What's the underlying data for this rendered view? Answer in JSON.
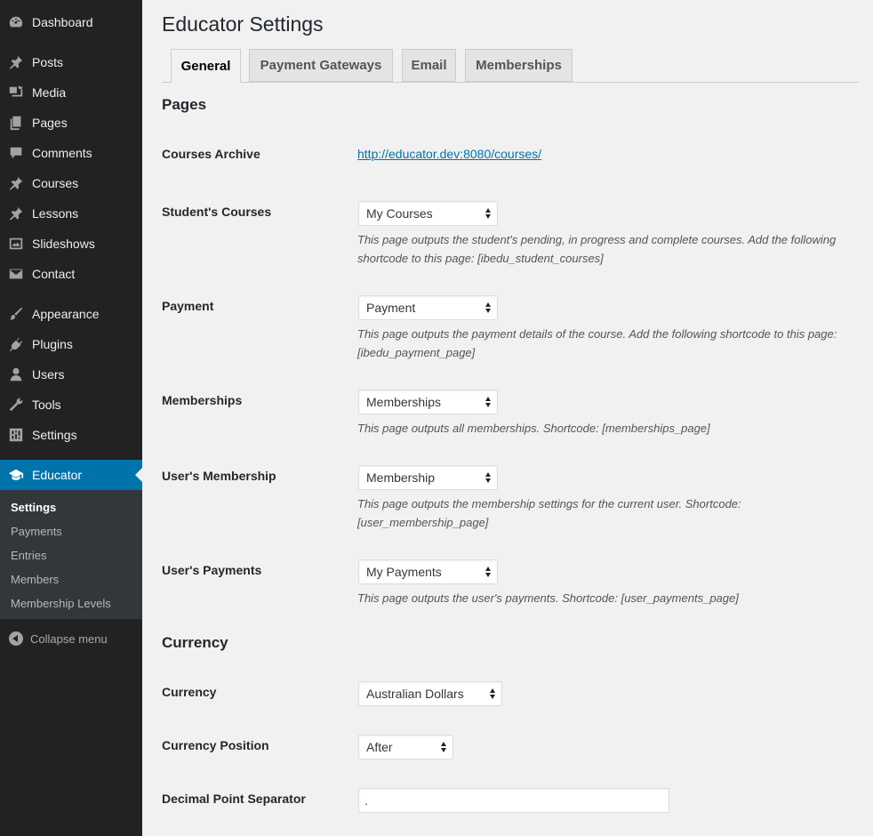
{
  "sidebar": {
    "items": [
      {
        "label": "Dashboard",
        "icon": "dashboard-icon"
      },
      {
        "label": "Posts",
        "icon": "pin-icon"
      },
      {
        "label": "Media",
        "icon": "media-icon"
      },
      {
        "label": "Pages",
        "icon": "pages-icon"
      },
      {
        "label": "Comments",
        "icon": "comment-icon"
      },
      {
        "label": "Courses",
        "icon": "pin-icon"
      },
      {
        "label": "Lessons",
        "icon": "pin-icon"
      },
      {
        "label": "Slideshows",
        "icon": "slideshow-icon"
      },
      {
        "label": "Contact",
        "icon": "mail-icon"
      },
      {
        "label": "Appearance",
        "icon": "brush-icon"
      },
      {
        "label": "Plugins",
        "icon": "plugin-icon"
      },
      {
        "label": "Users",
        "icon": "user-icon"
      },
      {
        "label": "Tools",
        "icon": "wrench-icon"
      },
      {
        "label": "Settings",
        "icon": "sliders-icon"
      },
      {
        "label": "Educator",
        "icon": "graduation-cap-icon"
      }
    ],
    "submenu": [
      "Settings",
      "Payments",
      "Entries",
      "Members",
      "Membership Levels"
    ],
    "collapse_label": "Collapse menu",
    "active_color": "#0073aa"
  },
  "page": {
    "title": "Educator Settings",
    "tabs": [
      "General",
      "Payment Gateways",
      "Email",
      "Memberships"
    ],
    "active_tab": "General"
  },
  "pages_section": {
    "title": "Pages",
    "courses_archive": {
      "label": "Courses Archive",
      "link": "http://educator.dev:8080/courses/"
    },
    "students_courses": {
      "label": "Student's Courses",
      "value": "My Courses",
      "desc": "This page outputs the student's pending, in progress and complete courses. Add the following shortcode to this page: [ibedu_student_courses]"
    },
    "payment": {
      "label": "Payment",
      "value": "Payment",
      "desc": "This page outputs the payment details of the course. Add the following shortcode to this page: [ibedu_payment_page]"
    },
    "memberships": {
      "label": "Memberships",
      "value": "Memberships",
      "desc": "This page outputs all memberships. Shortcode: [memberships_page]"
    },
    "users_membership": {
      "label": "User's Membership",
      "value": "Membership",
      "desc": "This page outputs the membership settings for the current user. Shortcode: [user_membership_page]"
    },
    "users_payments": {
      "label": "User's Payments",
      "value": "My Payments",
      "desc": "This page outputs the user's payments. Shortcode: [user_payments_page]"
    }
  },
  "currency_section": {
    "title": "Currency",
    "currency": {
      "label": "Currency",
      "value": "Australian Dollars"
    },
    "position": {
      "label": "Currency Position",
      "value": "After"
    },
    "decimal": {
      "label": "Decimal Point Separator",
      "value": "."
    }
  }
}
